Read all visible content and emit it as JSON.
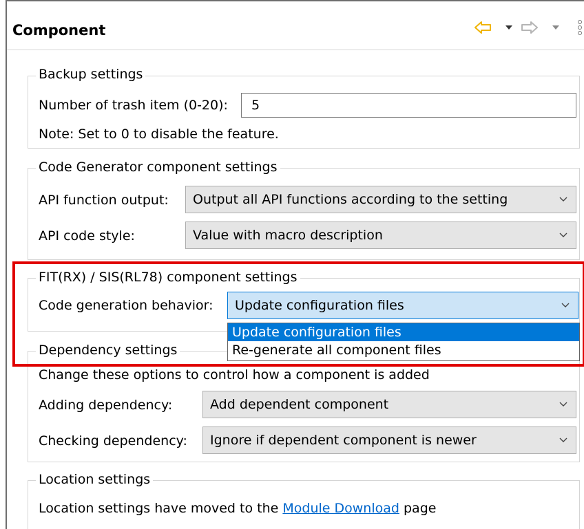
{
  "header": {
    "title": "Component"
  },
  "backup": {
    "legend": "Backup settings",
    "trash_label": "Number of trash item (0-20):",
    "trash_value": "5",
    "note": "Note: Set to 0 to disable the feature."
  },
  "codegen": {
    "legend": "Code Generator component settings",
    "api_output_label": "API function output:",
    "api_output_value": "Output all API functions according to the setting",
    "api_style_label": "API code style:",
    "api_style_value": "Value with macro description"
  },
  "fit": {
    "legend": "FIT(RX) / SIS(RL78) component settings",
    "behavior_label": "Code generation behavior:",
    "behavior_value": "Update configuration files",
    "options": [
      "Update configuration files",
      "Re-generate all component files"
    ]
  },
  "dependency": {
    "legend": "Dependency settings",
    "description": "Change these options to control how a component is added",
    "adding_label": "Adding dependency:",
    "adding_value": "Add dependent component",
    "checking_label": "Checking dependency:",
    "checking_value": "Ignore if dependent component is newer"
  },
  "location": {
    "legend": "Location settings",
    "text_before": "Location settings have moved to the ",
    "link_text": "Module Download",
    "text_after": " page"
  },
  "colors": {
    "highlight_border": "#e00000",
    "selected_item": "#0078d7",
    "focused_combo": "#cce4f7",
    "link": "#0066cc",
    "back_arrow": "#f0b400"
  },
  "icons": [
    "back-arrow-icon",
    "back-menu-icon",
    "forward-arrow-icon",
    "forward-menu-icon",
    "view-menu-icon",
    "chevron-down-icon"
  ]
}
